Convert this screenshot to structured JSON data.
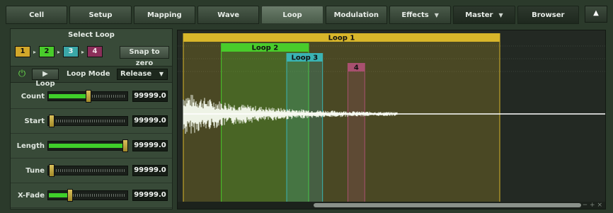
{
  "tabs": [
    {
      "label": "Cell",
      "active": false,
      "dropdown": false
    },
    {
      "label": "Setup",
      "active": false,
      "dropdown": false
    },
    {
      "label": "Mapping",
      "active": false,
      "dropdown": false
    },
    {
      "label": "Wave",
      "active": false,
      "dropdown": false
    },
    {
      "label": "Loop",
      "active": true,
      "dropdown": false
    },
    {
      "label": "Modulation",
      "active": false,
      "dropdown": false
    },
    {
      "label": "Effects",
      "active": false,
      "dropdown": true
    },
    {
      "label": "Master",
      "active": false,
      "dropdown": true
    },
    {
      "label": "Browser",
      "active": false,
      "dropdown": false
    }
  ],
  "collapse_icon": "▲",
  "panel": {
    "title": "Select Loop",
    "loops": [
      "1",
      "2",
      "3",
      "4"
    ],
    "snap_label": "Snap to zero",
    "loop_toggle_label": "Loop",
    "loop_mode_label": "Loop Mode",
    "loop_mode_value": "Release",
    "params": [
      {
        "label": "Count",
        "value": "99999.0",
        "level": 0.5,
        "filled": true
      },
      {
        "label": "Start",
        "value": "99999.0",
        "level": 0.0,
        "filled": false
      },
      {
        "label": "Length",
        "value": "99999.0",
        "level": 1.0,
        "filled": true
      },
      {
        "label": "Tune",
        "value": "99999.0",
        "level": 0.0,
        "filled": false
      },
      {
        "label": "X-Fade",
        "value": "99999.0",
        "level": 0.25,
        "filled": true
      }
    ]
  },
  "waveform": {
    "loops": [
      {
        "label": "Loop 1",
        "start": 0.0,
        "end": 0.75,
        "color": "#d8b62a",
        "row": 0
      },
      {
        "label": "Loop 2",
        "start": 0.09,
        "end": 0.297,
        "color": "#49cc2b",
        "row": 1
      },
      {
        "label": "Loop 3",
        "start": 0.245,
        "end": 0.33,
        "color": "#3ab3b3",
        "row": 2
      },
      {
        "label": "4",
        "start": 0.39,
        "end": 0.43,
        "color": "#a8506f",
        "row": 3
      }
    ],
    "zoom_label": "− + ×"
  },
  "colors": {
    "accent": "#49cc2b",
    "background": "#2b3a2b"
  }
}
